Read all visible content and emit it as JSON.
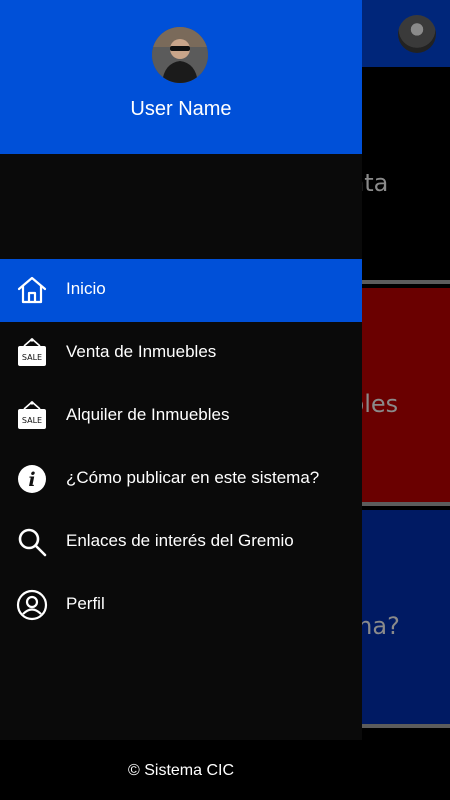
{
  "background": {
    "cards": [
      {
        "text": "nta"
      },
      {
        "text": "bles"
      },
      {
        "text": "ma?"
      }
    ]
  },
  "drawer": {
    "user_name": "User Name",
    "menu": [
      {
        "label": "Inicio",
        "icon": "home-icon",
        "active": true
      },
      {
        "label": "Venta de Inmuebles",
        "icon": "sale-sign-icon",
        "active": false
      },
      {
        "label": "Alquiler de Inmuebles",
        "icon": "sale-sign-icon",
        "active": false
      },
      {
        "label": "¿Cómo publicar en este sistema?",
        "icon": "info-icon",
        "active": false
      },
      {
        "label": "Enlaces de interés del Gremio",
        "icon": "search-icon",
        "active": false
      },
      {
        "label": "Perfil",
        "icon": "user-circle-icon",
        "active": false
      }
    ],
    "sale_sign_text": "SALE"
  },
  "footer": {
    "text": "© Sistema CIC"
  },
  "colors": {
    "accent": "#0050d8",
    "drawer_bg": "#0a0a0a",
    "card_red": "#6a0000",
    "card_blue": "#001a63"
  }
}
